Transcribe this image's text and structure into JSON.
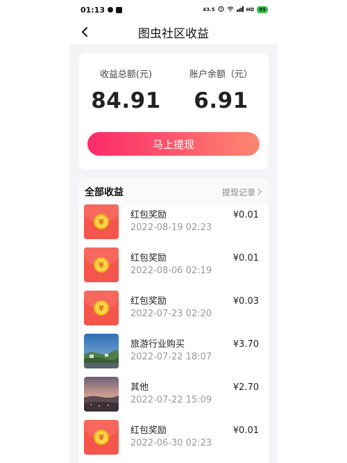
{
  "status_bar": {
    "time": "01:13",
    "network_speed": "43.5",
    "signal_text": "HD",
    "battery": "95"
  },
  "nav": {
    "title": "图虫社区收益"
  },
  "summary": {
    "total_label": "收益总额(元)",
    "total_value": "84.91",
    "balance_label": "账户余额（元）",
    "balance_value": "6.91",
    "withdraw_label": "马上提现",
    "button_gradient": [
      "#fb2a6a",
      "#fb8770"
    ]
  },
  "list": {
    "title": "全部收益",
    "history_link": "提现记录",
    "items": [
      {
        "icon": "red-packet",
        "title": "红包奖励",
        "date": "2022-08-19 02:23",
        "amount": "¥0.01"
      },
      {
        "icon": "red-packet",
        "title": "红包奖励",
        "date": "2022-08-06 02:19",
        "amount": "¥0.01"
      },
      {
        "icon": "red-packet",
        "title": "红包奖励",
        "date": "2022-07-23 02:20",
        "amount": "¥0.03"
      },
      {
        "icon": "landscape-photo",
        "title": "旅游行业购买",
        "date": "2022-07-22 18:07",
        "amount": "¥3.70"
      },
      {
        "icon": "sunset-photo",
        "title": "其他",
        "date": "2022-07-22 15:09",
        "amount": "¥2.70"
      },
      {
        "icon": "red-packet",
        "title": "红包奖励",
        "date": "2022-06-30 02:23",
        "amount": "¥0.01"
      }
    ]
  }
}
